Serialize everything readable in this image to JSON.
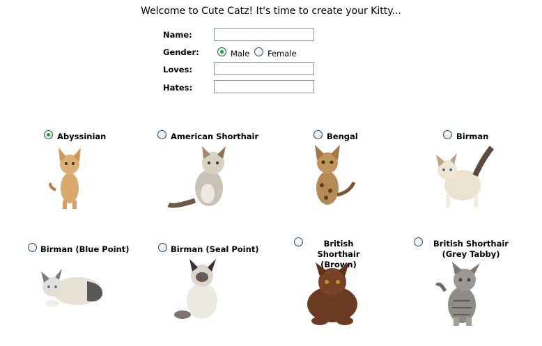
{
  "title": "Welcome to Cute Catz! It's time to create your Kitty...",
  "form": {
    "name_label": "Name:",
    "gender_label": "Gender:",
    "loves_label": "Loves:",
    "hates_label": "Hates:",
    "name_value": "",
    "loves_value": "",
    "hates_value": "",
    "gender_options": [
      "Male",
      "Female"
    ],
    "gender_selected": "Male"
  },
  "breeds": [
    {
      "label": "Abyssinian",
      "selected": true
    },
    {
      "label": "American Shorthair",
      "selected": false
    },
    {
      "label": "Bengal",
      "selected": false
    },
    {
      "label": "Birman",
      "selected": false
    },
    {
      "label": "Birman (Blue Point)",
      "selected": false
    },
    {
      "label": "Birman (Seal Point)",
      "selected": false
    },
    {
      "label": "British Shorthair (Brown)",
      "selected": false
    },
    {
      "label": "British Shorthair (Grey Tabby)",
      "selected": false
    }
  ],
  "colors": {
    "radio_border": "#1c5180",
    "radio_checked": "#21a121",
    "input_border": "#7f9db9"
  }
}
